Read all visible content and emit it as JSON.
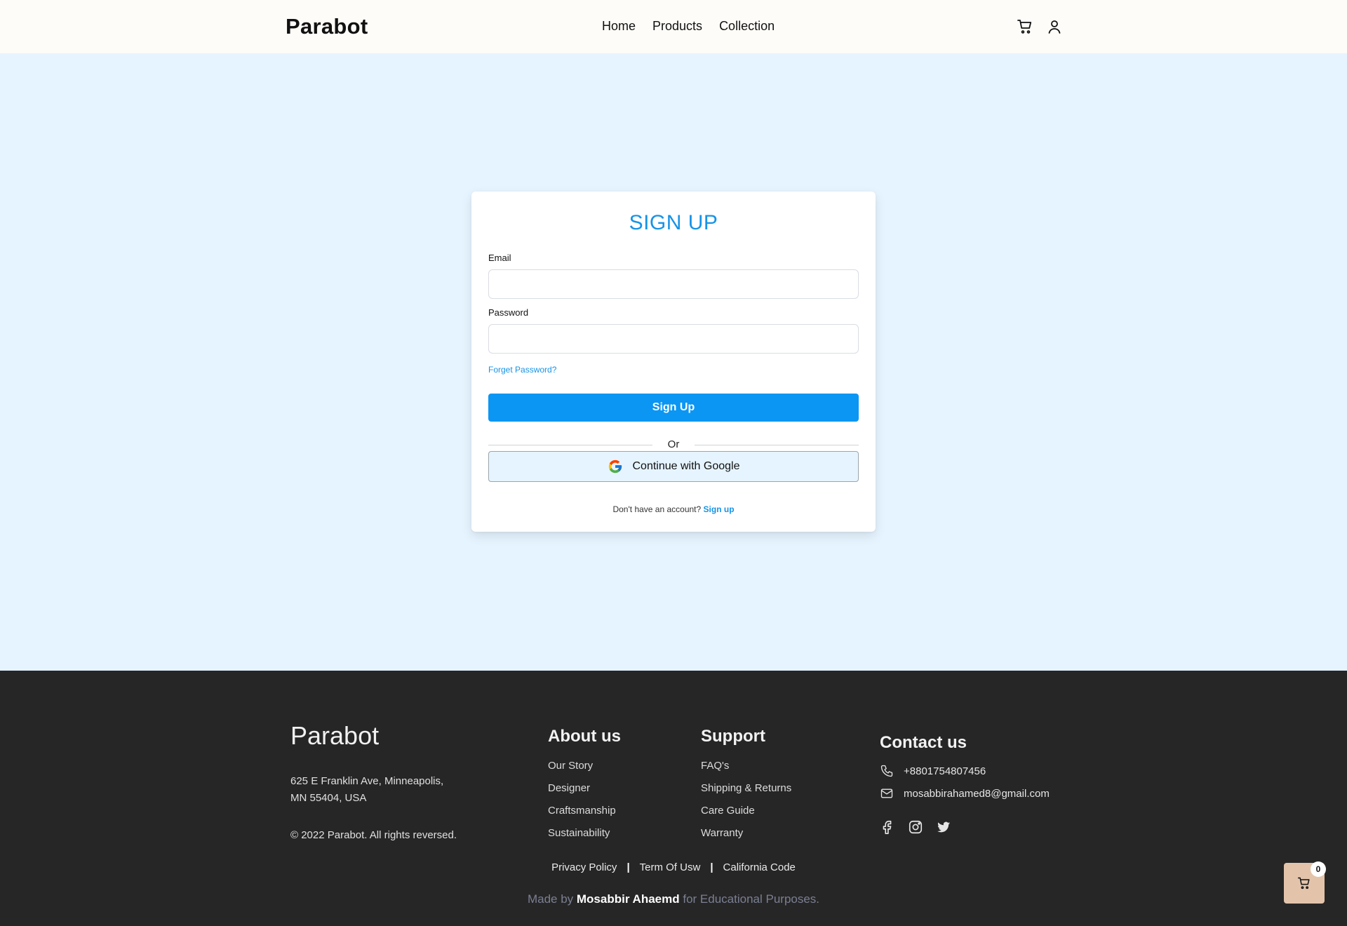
{
  "header": {
    "brand": "Parabot",
    "nav": [
      "Home",
      "Products",
      "Collection"
    ],
    "icons": [
      "cart-icon",
      "user-icon"
    ]
  },
  "signup": {
    "title": "SIGN UP",
    "email_label": "Email",
    "email_value": "",
    "password_label": "Password",
    "password_value": "",
    "forgot": "Forget Password?",
    "submit": "Sign Up",
    "or": "Or",
    "google": "Continue with Google",
    "no_account": "Don't have an account?",
    "signup_link": "Sign up"
  },
  "footer": {
    "brand": "Parabot",
    "address_line1": "625 E Franklin Ave, Minneapolis,",
    "address_line2": "MN 55404, USA",
    "copyright": "© 2022 Parabot. All rights reversed.",
    "about": {
      "title": "About us",
      "links": [
        "Our Story",
        "Designer",
        "Craftsmanship",
        "Sustainability"
      ]
    },
    "support": {
      "title": "Support",
      "links": [
        "FAQ's",
        "Shipping & Returns",
        "Care Guide",
        "Warranty"
      ]
    },
    "contact": {
      "title": "Contact us",
      "phone": "+8801754807456",
      "email": "mosabbirahamed8@gmail.com",
      "social": [
        "facebook-icon",
        "instagram-icon",
        "twitter-icon"
      ]
    },
    "legal": [
      "Privacy Policy",
      "Term Of Usw",
      "California Code"
    ],
    "made_prefix": "Made by",
    "made_name": "Mosabbir Ahaemd",
    "made_suffix": "for Educational Purposes."
  },
  "floating_cart": {
    "count": "0"
  },
  "colors": {
    "accent": "#0b96f3",
    "page_bg": "#e6f4ff",
    "footer_bg": "#262626",
    "cart_button": "#e3c4ab"
  }
}
